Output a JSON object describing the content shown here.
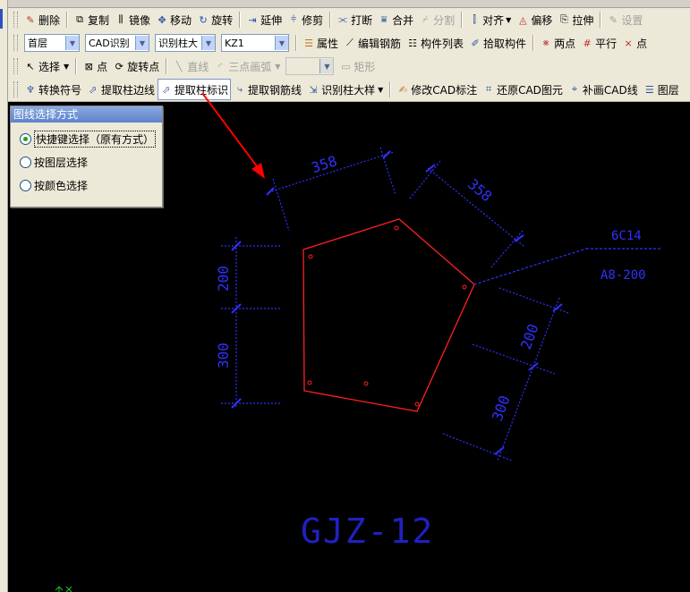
{
  "toolbar1": {
    "delete": "删除",
    "copy": "复制",
    "mirror": "镜像",
    "move": "移动",
    "rotate": "旋转",
    "extend": "延伸",
    "trim": "修剪",
    "break": "打断",
    "merge": "合并",
    "split": "分割",
    "align": "对齐",
    "offset": "偏移",
    "stretch": "拉伸",
    "settings": "设置"
  },
  "toolbar2": {
    "floor": "首层",
    "cad_recognize": "CAD识别",
    "recognize_col": "识别柱大",
    "component": "KZ1",
    "properties": "属性",
    "edit_rebar": "编辑钢筋",
    "component_list": "构件列表",
    "pick_component": "拾取构件",
    "two_points": "两点",
    "parallel": "平行",
    "point": "点"
  },
  "toolbar3": {
    "select": "选择",
    "point": "点",
    "rotate_point": "旋转点",
    "line": "直线",
    "three_point_arc": "三点画弧",
    "rectangle": "矩形"
  },
  "toolbar4": {
    "convert_symbol": "转换符号",
    "extract_col_edge": "提取柱边线",
    "extract_col_label": "提取柱标识",
    "extract_rebar_line": "提取钢筋线",
    "recognize_col_detail": "识别柱大样",
    "modify_cad_label": "修改CAD标注",
    "restore_cad": "还原CAD图元",
    "draw_cad_line": "补画CAD线",
    "layer": "图层"
  },
  "panel": {
    "title": "图线选择方式",
    "options": [
      "快捷键选择（原有方式）",
      "按图层选择",
      "按颜色选择"
    ],
    "selected": 0
  },
  "drawing": {
    "dim_top_left": "358",
    "dim_top_right": "358",
    "dim_left_upper": "200",
    "dim_left_lower": "300",
    "dim_right_upper": "200",
    "dim_right_lower": "300",
    "rebar_main": "6C14",
    "rebar_stirrup": "A8-200",
    "title": "GJZ-12"
  },
  "colors": {
    "outline": "#ff2020",
    "dims": "#3030ff",
    "arrow": "#ff0000",
    "canvas": "#000000"
  }
}
